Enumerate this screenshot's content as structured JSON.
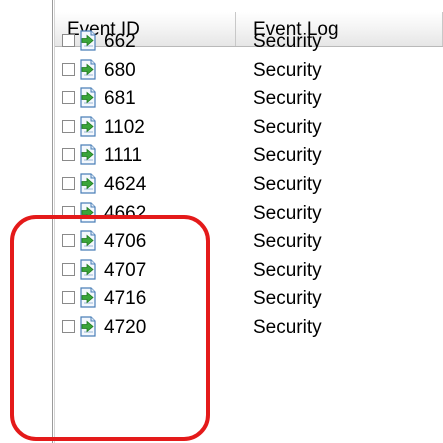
{
  "columns": {
    "event_id": "Event ID",
    "event_log": "Event Log"
  },
  "rows": [
    {
      "id": "662",
      "log": "Security"
    },
    {
      "id": "680",
      "log": "Security"
    },
    {
      "id": "681",
      "log": "Security"
    },
    {
      "id": "1102",
      "log": "Security"
    },
    {
      "id": "1111",
      "log": "Security"
    },
    {
      "id": "4624",
      "log": "Security"
    },
    {
      "id": "4662",
      "log": "Security"
    },
    {
      "id": "4706",
      "log": "Security"
    },
    {
      "id": "4707",
      "log": "Security"
    },
    {
      "id": "4716",
      "log": "Security"
    },
    {
      "id": "4720",
      "log": "Security"
    }
  ],
  "row_checked": [
    false,
    false,
    false,
    false,
    false,
    false,
    false,
    false,
    false,
    false,
    false
  ],
  "icons": {
    "row_icon": "event-arrow-icon",
    "checkbox": "checkbox-icon"
  },
  "colors": {
    "highlight": "#e41a1a",
    "icon_arrow": "#3aa53a",
    "icon_page": "#4a7fb8"
  }
}
